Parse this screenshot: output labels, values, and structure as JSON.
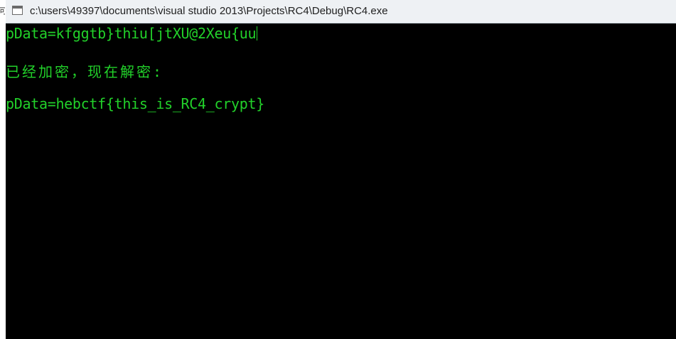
{
  "window": {
    "title": "c:\\users\\49397\\documents\\visual studio 2013\\Projects\\RC4\\Debug\\RC4.exe",
    "background_color": "#000000",
    "text_color": "#22d12a",
    "titlebar_color": "#eef1f4"
  },
  "left_strip": {
    "glyph": "可"
  },
  "console": {
    "lines": [
      "pDataﾠ=kfggtb}thiu[jtXU@2Xeu{uu|",
      "已经加密，现在解密:",
      "pData=hebctf{this_is_RC4_crypt}"
    ]
  }
}
